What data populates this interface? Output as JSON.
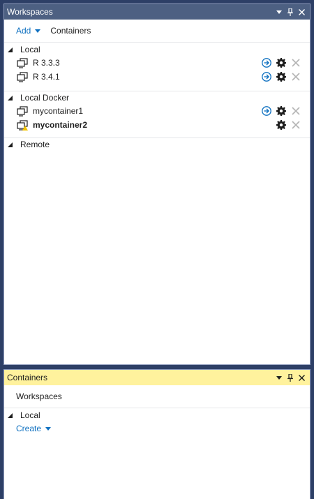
{
  "workspaces_panel": {
    "title": "Workspaces",
    "toolbar": {
      "add_label": "Add",
      "containers_label": "Containers"
    },
    "sections": {
      "local": {
        "label": "Local",
        "items": [
          {
            "name": "R 3.3.3"
          },
          {
            "name": "R 3.4.1"
          }
        ]
      },
      "local_docker": {
        "label": "Local Docker",
        "items": [
          {
            "name": "mycontainer1"
          },
          {
            "name": "mycontainer2"
          }
        ]
      },
      "remote": {
        "label": "Remote"
      }
    }
  },
  "containers_panel": {
    "title": "Containers",
    "toolbar": {
      "workspaces_label": "Workspaces"
    },
    "sections": {
      "local": {
        "label": "Local",
        "create_label": "Create"
      }
    }
  },
  "colors": {
    "accent": "#0e70c0",
    "active_title": "#fff29d",
    "inactive_title": "#4d6082",
    "warning": "#f2c300"
  }
}
